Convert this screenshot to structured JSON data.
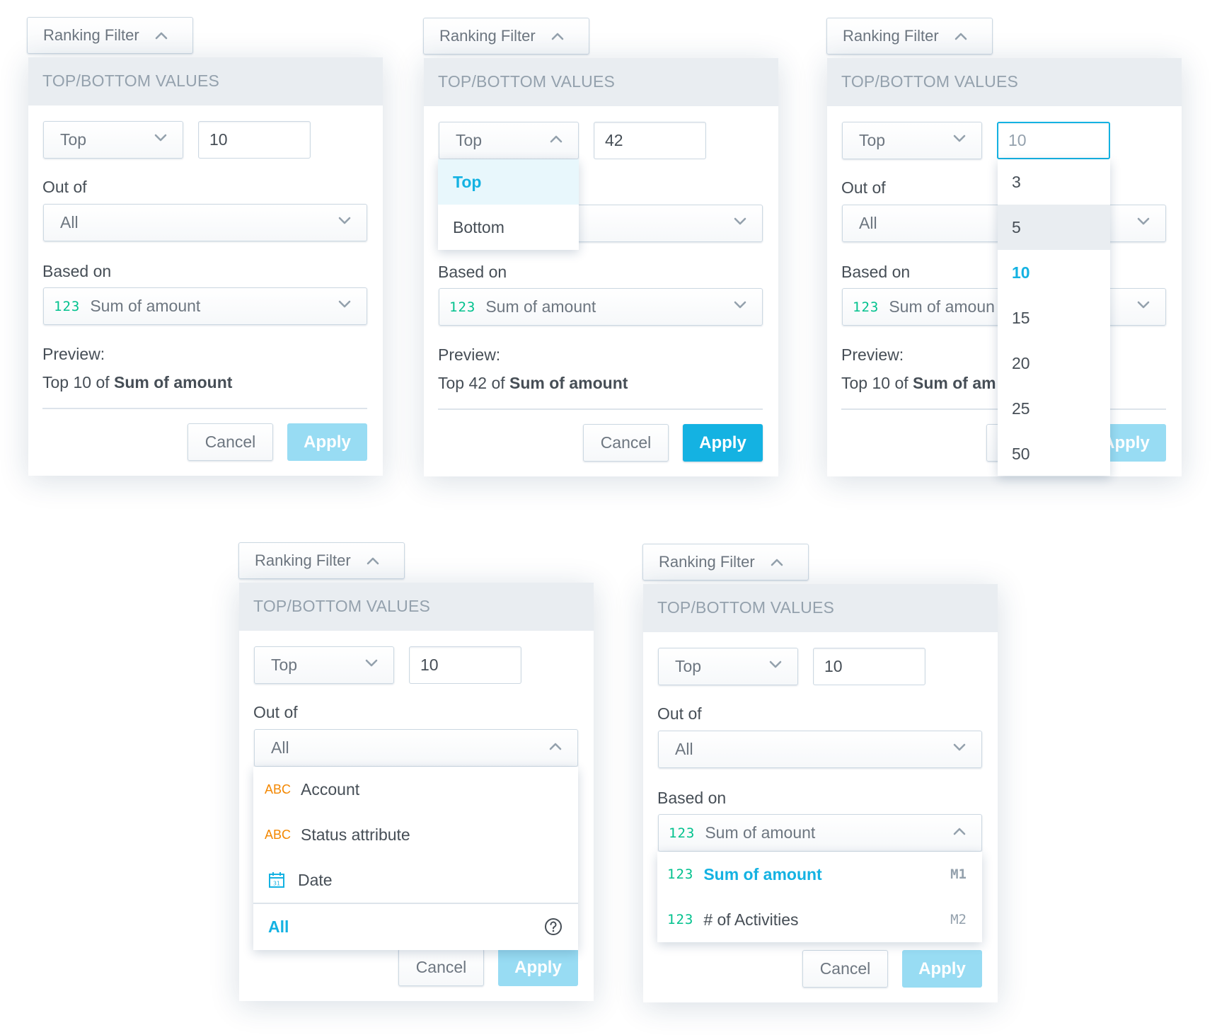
{
  "colors": {
    "accent": "#14b2e2",
    "accent_disabled": "#98dcf3",
    "header_bg": "#e9edf1",
    "measure_icon": "#00c18d",
    "attribute_icon": "#f38700"
  },
  "common": {
    "trigger_label": "Ranking Filter",
    "header_title": "TOP/BOTTOM VALUES",
    "out_of_label": "Out of",
    "based_on_label": "Based on",
    "preview_label": "Preview:",
    "cancel_label": "Cancel",
    "apply_label": "Apply",
    "measure_icon_text": "123",
    "attribute_icon_text": "ABC"
  },
  "panels": [
    {
      "id": "a",
      "operator": "Top",
      "value": "10",
      "out_of": "All",
      "based_on": "Sum of amount",
      "preview_prefix": "Top 10 of ",
      "preview_measure": "Sum of amount",
      "apply_enabled": false
    },
    {
      "id": "b",
      "operator": "Top",
      "value": "42",
      "out_of": "All",
      "based_on": "Sum of amount",
      "preview_prefix": "Top 42 of ",
      "preview_measure": "Sum of amount",
      "apply_enabled": true,
      "operator_dropdown": {
        "open": true,
        "options": [
          "Top",
          "Bottom"
        ],
        "selected": "Top"
      }
    },
    {
      "id": "c",
      "operator": "Top",
      "value": "10",
      "out_of": "All",
      "based_on": "Sum of amoun",
      "preview_prefix": "Top 10 of ",
      "preview_measure": "Sum of am",
      "apply_enabled": false,
      "value_dropdown": {
        "open": true,
        "options": [
          "3",
          "5",
          "10",
          "15",
          "20",
          "25",
          "50"
        ],
        "selected": "10",
        "hovered": "5"
      }
    },
    {
      "id": "d",
      "operator": "Top",
      "value": "10",
      "out_of": "All",
      "apply_enabled": false,
      "out_of_dropdown": {
        "open": true,
        "items": [
          {
            "type": "attribute",
            "icon": "ABC",
            "label": "Account"
          },
          {
            "type": "attribute",
            "icon": "ABC",
            "label": "Status attribute"
          },
          {
            "type": "date",
            "icon": "calendar",
            "label": "Date"
          }
        ],
        "all_label": "All",
        "help_icon": "question-circle"
      }
    },
    {
      "id": "e",
      "operator": "Top",
      "value": "10",
      "out_of": "All",
      "based_on": "Sum of amount",
      "apply_enabled": false,
      "based_on_dropdown": {
        "open": true,
        "items": [
          {
            "icon": "123",
            "label": "Sum of amount",
            "code": "M1",
            "selected": true
          },
          {
            "icon": "123",
            "label": "# of Activities",
            "code": "M2",
            "selected": false
          }
        ]
      }
    }
  ]
}
